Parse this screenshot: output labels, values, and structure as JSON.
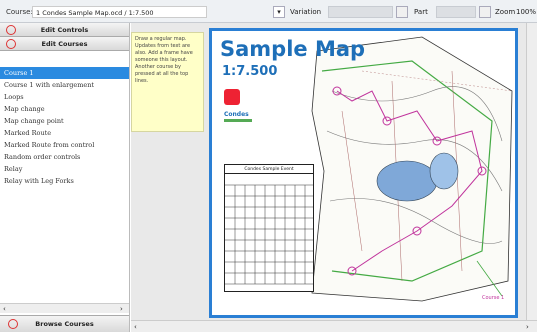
{
  "toolbar": {
    "course_label": "Course:",
    "course_value": "1 Condes Sample Map.ocd  / 1:7.500",
    "variation_label": "Variation",
    "part_label": "Part",
    "zoom_label": "Zoom",
    "zoom_value": "100%"
  },
  "left_panel": {
    "edit_controls_label": "Edit Controls",
    "edit_courses_label": "Edit Courses",
    "courses": [
      "Course 1",
      "Course 1 with enlargement",
      "Loops",
      "Map change",
      "Map change point",
      "Marked Route",
      "Marked Route from control",
      "Random order controls",
      "Relay",
      "Relay with Leg Forks"
    ],
    "selected_index": 0,
    "browse_label": "Browse Courses"
  },
  "notes": {
    "text": "Draw a regular map. Updates from text are also. Add a frame have someone this layout. Another course by pressed at all the top lines."
  },
  "map": {
    "title": "Sample Map",
    "scale": "1:7.500",
    "brand": "Condes",
    "desc_title": "Condes Sample Event",
    "course_label": "Course 1"
  },
  "colors": {
    "accent": "#2a7fd4",
    "selection": "#2a8ae0",
    "title": "#1e6fb8"
  }
}
